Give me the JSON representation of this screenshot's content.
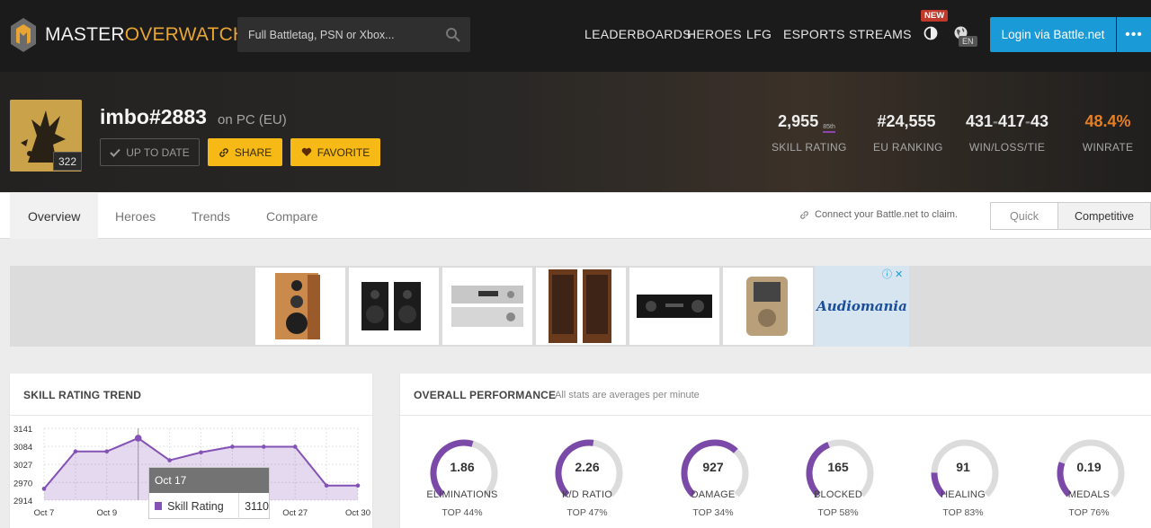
{
  "brand": {
    "part1": "MASTER",
    "part2": "OVERWATCH"
  },
  "search": {
    "placeholder": "Full Battletag, PSN or Xbox..."
  },
  "nav": {
    "links": [
      "LEADERBOARDS",
      "HEROES",
      "LFG",
      "ESPORTS",
      "STREAMS"
    ],
    "new_badge": "NEW",
    "lang": "EN",
    "login": "Login via Battle.net",
    "more": "•••"
  },
  "profile": {
    "name": "imbo#2883",
    "platform": "on PC (EU)",
    "level": "322",
    "buttons": {
      "uptodate": "UP TO DATE",
      "share": "SHARE",
      "favorite": "FAVORITE"
    },
    "stats": {
      "skill_rating": "2,955",
      "skill_pct": "85th",
      "skill_label": "SKILL RATING",
      "ranking": "#24,555",
      "ranking_label": "EU RANKING",
      "wins": "431",
      "losses": "417",
      "ties": "43",
      "wlt_label": "WIN/LOSS/TIE",
      "winrate": "48.4%",
      "winrate_label": "WINRATE"
    }
  },
  "subnav": {
    "tabs": [
      "Overview",
      "Heroes",
      "Trends",
      "Compare"
    ],
    "claim": "Connect your Battle.net to claim.",
    "modes": [
      "Quick",
      "Competitive"
    ]
  },
  "ad": {
    "brand": "Audiomania"
  },
  "colors": {
    "accent": "#f6b915",
    "login": "#1a9ad6",
    "winrate": "#e67e22",
    "chart": "#8452b5"
  },
  "sr_trend": {
    "title": "SKILL RATING TREND",
    "tooltip": {
      "date": "Oct 17",
      "label": "Skill Rating",
      "value": "3110"
    }
  },
  "chart_data": {
    "type": "area",
    "title": "SKILL RATING TREND",
    "yticks": [
      3141,
      3084,
      3027,
      2970,
      2914
    ],
    "ylim": [
      2914,
      3141
    ],
    "xtick_labels": [
      "Oct 7",
      "Oct 9",
      "Oct 17",
      "Oct 27",
      "Oct 30"
    ],
    "series": [
      {
        "name": "Skill Rating",
        "values": [
          2950,
          3068,
          3068,
          3110,
          3040,
          3065,
          3083,
          3083,
          3083,
          2960,
          2960
        ]
      }
    ],
    "grid": true
  },
  "performance": {
    "title": "OVERALL PERFORMANCE",
    "subtitle": "All stats are averages per minute",
    "items": [
      {
        "value": "1.86",
        "label": "ELIMINATIONS",
        "top": "TOP 44%",
        "pct": 56
      },
      {
        "value": "2.26",
        "label": "K/D RATIO",
        "top": "TOP 47%",
        "pct": 53
      },
      {
        "value": "927",
        "label": "DAMAGE",
        "top": "TOP 34%",
        "pct": 66
      },
      {
        "value": "165",
        "label": "BLOCKED",
        "top": "TOP 58%",
        "pct": 42
      },
      {
        "value": "91",
        "label": "HEALING",
        "top": "TOP 83%",
        "pct": 17
      },
      {
        "value": "0.19",
        "label": "MEDALS",
        "top": "TOP 76%",
        "pct": 24
      }
    ]
  }
}
